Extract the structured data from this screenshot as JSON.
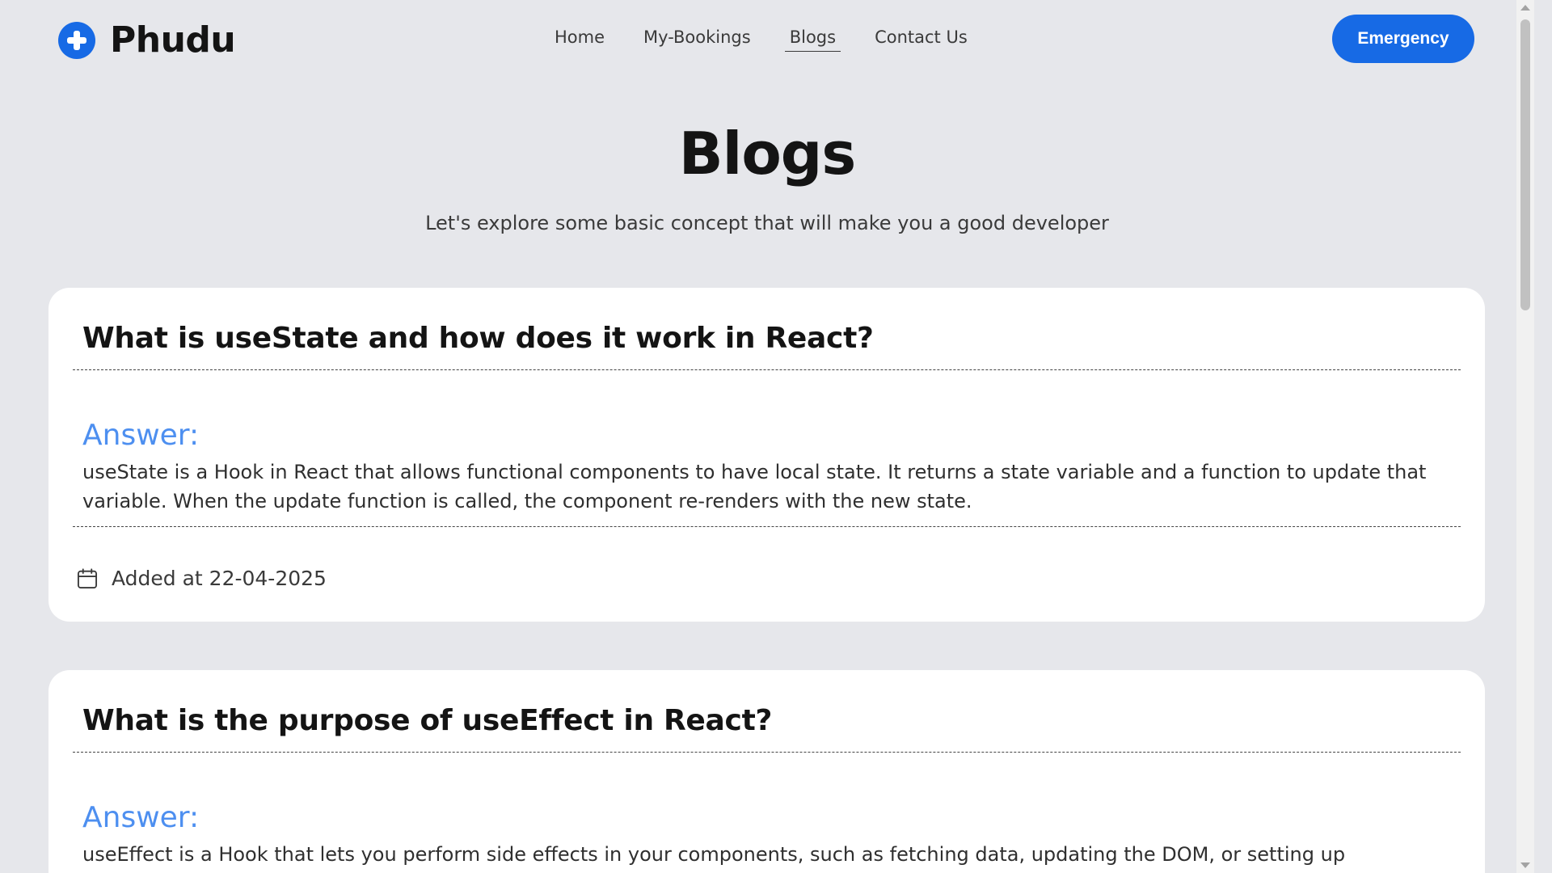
{
  "navbar": {
    "brand_name": "Phudu",
    "brand_icon": "medical-plus-icon",
    "links": [
      "Home",
      "My-Bookings",
      "Blogs",
      "Contact Us"
    ],
    "active_link": "Blogs",
    "emergency_label": "Emergency"
  },
  "header": {
    "title": "Blogs",
    "subtitle": "Let's explore some basic concept that will make you a good developer"
  },
  "blogs": [
    {
      "question": "What is useState and how does it work in React?",
      "answer_label": "Answer:",
      "answer": "useState is a Hook in React that allows functional components to have local state. It returns a state variable and a function to update that variable. When the update function is called, the component re-renders with the new state.",
      "added_at": "Added at 22-04-2025",
      "date_icon": "calendar-icon"
    },
    {
      "question": "What is the purpose of useEffect in React?",
      "answer_label": "Answer:",
      "answer": "useEffect is a Hook that lets you perform side effects in your components, such as fetching data, updating the DOM, or setting up subscriptions. It"
    }
  ],
  "colors": {
    "page_background": "#e6e7eb",
    "primary": "#176ae5",
    "answer_label": "#4d8ff0",
    "card_background": "#ffffff"
  }
}
